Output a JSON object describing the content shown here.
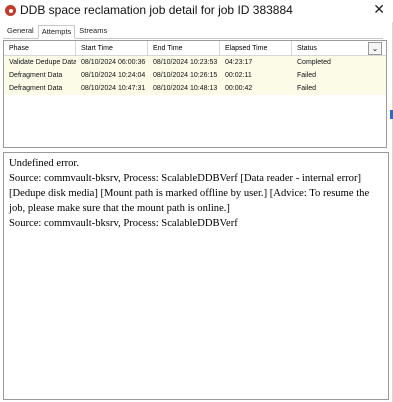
{
  "window": {
    "title": "DDB space reclamation job detail for job ID 383884",
    "close_glyph": "✕"
  },
  "tabs": [
    {
      "label": "General",
      "active": false
    },
    {
      "label": "Attempts",
      "active": true
    },
    {
      "label": "Streams",
      "active": false
    }
  ],
  "grid": {
    "columns": [
      "Phase",
      "Start Time",
      "End Time",
      "Elapsed Time",
      "Status"
    ],
    "menu_glyph": "⌄",
    "rows": [
      [
        "Validate Dedupe Data",
        "08/10/2024 06:00:36",
        "08/10/2024 10:23:53",
        "04:23:17",
        "Completed"
      ],
      [
        "Defragment Data",
        "08/10/2024 10:24:04",
        "08/10/2024 10:26:15",
        "00:02:11",
        "Failed"
      ],
      [
        "Defragment Data",
        "08/10/2024 10:47:31",
        "08/10/2024 10:48:13",
        "00:00:42",
        "Failed"
      ]
    ]
  },
  "details": {
    "line1": "Undefined error.",
    "line2": "Source: commvault-bksrv, Process: ScalableDDBVerf [Data reader - internal error] [Dedupe disk media] [Mount path is marked offline by user.] [Advice: To resume the job, please make sure that the mount path is online.]",
    "line3": "Source: commvault-bksrv, Process: ScalableDDBVerf"
  },
  "colors": {
    "row_highlight": "#fbfbe8",
    "app_icon": "#c0392b"
  }
}
